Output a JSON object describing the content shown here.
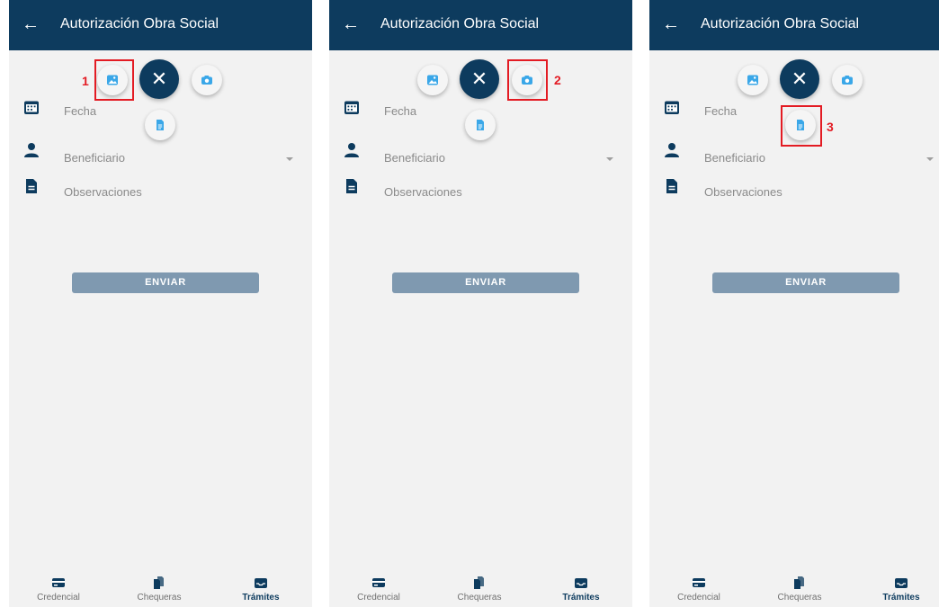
{
  "colors": {
    "app_bar": "#0d3b5e",
    "highlight": "#e31b23",
    "button": "#7f99b0",
    "icon_accent": "#3aa7e8"
  },
  "screens": [
    {
      "app_title": "Autorización Obra Social",
      "fields": {
        "date": "Fecha",
        "beneficiary": "Beneficiario",
        "notes": "Observaciones"
      },
      "send_label": "ENVIAR",
      "step_number": "1",
      "nav": {
        "credential": "Credencial",
        "checkbooks": "Chequeras",
        "procedures": "Trámites"
      }
    },
    {
      "app_title": "Autorización Obra Social",
      "fields": {
        "date": "Fecha",
        "beneficiary": "Beneficiario",
        "notes": "Observaciones"
      },
      "send_label": "ENVIAR",
      "step_number": "2",
      "nav": {
        "credential": "Credencial",
        "checkbooks": "Chequeras",
        "procedures": "Trámites"
      }
    },
    {
      "app_title": "Autorización Obra Social",
      "fields": {
        "date": "Fecha",
        "beneficiary": "Beneficiario",
        "notes": "Observaciones"
      },
      "send_label": "ENVIAR",
      "step_number": "3",
      "nav": {
        "credential": "Credencial",
        "checkbooks": "Chequeras",
        "procedures": "Trámites"
      }
    }
  ]
}
